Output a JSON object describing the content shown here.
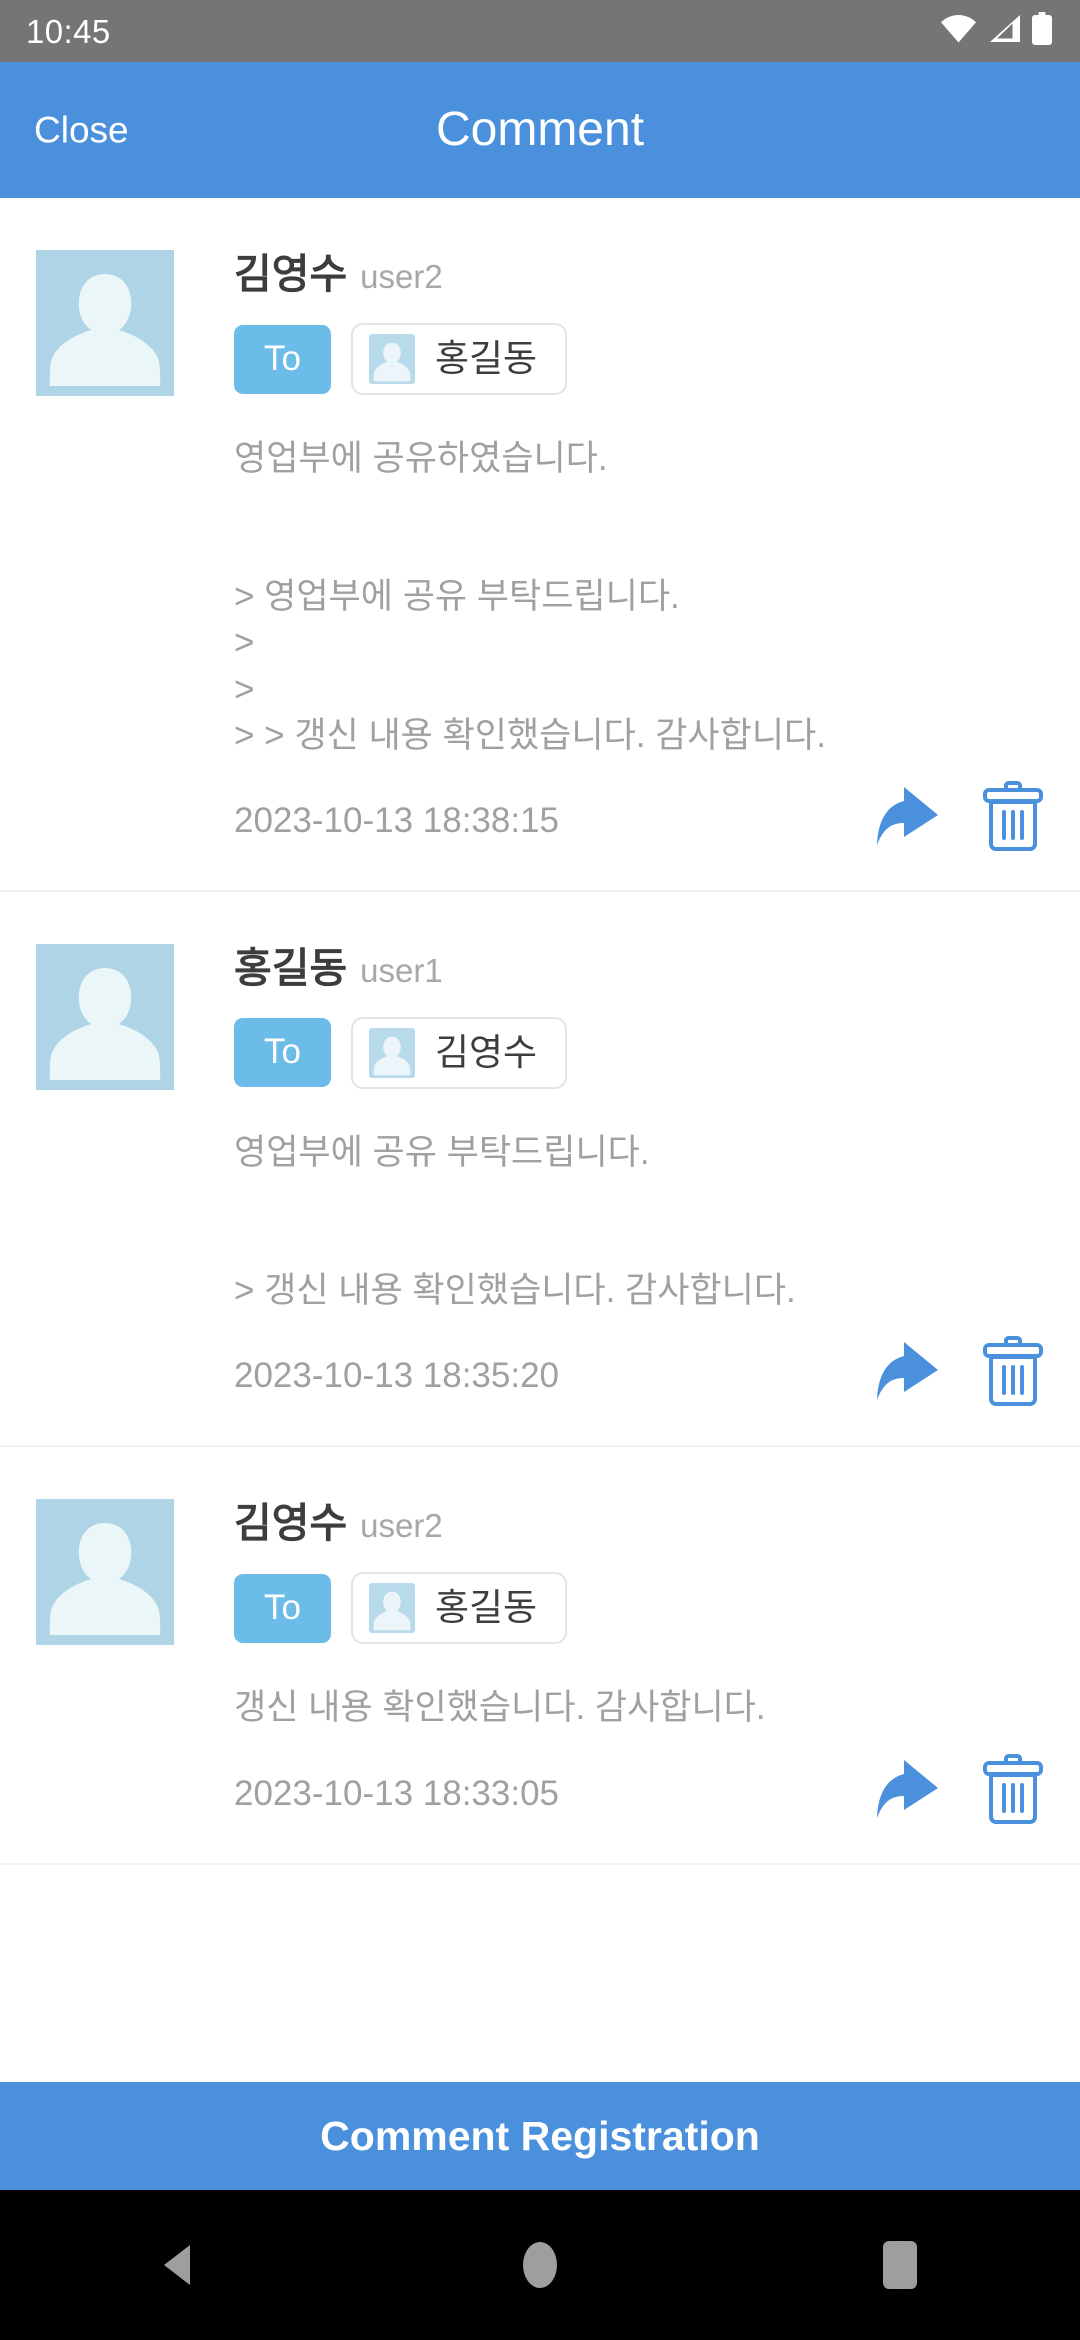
{
  "statusbar": {
    "time": "10:45",
    "icons": [
      "wifi-icon",
      "cellular-signal-icon",
      "battery-icon"
    ]
  },
  "header": {
    "close_label": "Close",
    "title": "Comment",
    "background_color": "#4a90dd"
  },
  "colors": {
    "accent_blue": "#4a90dd",
    "to_badge_blue": "#6cbce9",
    "avatar_blue": "#aed4e6",
    "icon_blue": "#4a90dd",
    "body_text_gray": "#a0a0a0",
    "name_text": "#3d3d3d",
    "divider": "#f1f2f3",
    "statusbar_gray": "#757575"
  },
  "comments": [
    {
      "author_name": "김영수",
      "author_id": "user2",
      "to_label": "To",
      "recipient": "홍길동",
      "body_lines": [
        "영업부에 공유하였습니다.",
        "",
        "",
        "> 영업부에 공유 부탁드립니다.",
        ">",
        ">",
        "> > 갱신 내용 확인했습니다. 감사합니다."
      ],
      "timestamp": "2023-10-13 18:38:15",
      "actions": [
        "reply-icon",
        "delete-icon"
      ]
    },
    {
      "author_name": "홍길동",
      "author_id": "user1",
      "to_label": "To",
      "recipient": "김영수",
      "body_lines": [
        "영업부에 공유 부탁드립니다.",
        "",
        "",
        "> 갱신 내용 확인했습니다. 감사합니다."
      ],
      "timestamp": "2023-10-13 18:35:20",
      "actions": [
        "reply-icon",
        "delete-icon"
      ]
    },
    {
      "author_name": "김영수",
      "author_id": "user2",
      "to_label": "To",
      "recipient": "홍길동",
      "body_lines": [
        "갱신 내용 확인했습니다. 감사합니다."
      ],
      "timestamp": "2023-10-13 18:33:05",
      "actions": [
        "reply-icon",
        "delete-icon"
      ]
    }
  ],
  "footer": {
    "register_label": "Comment Registration"
  },
  "navbar": {
    "back_label": "back-icon",
    "home_label": "home-icon",
    "recents_label": "recents-icon"
  }
}
